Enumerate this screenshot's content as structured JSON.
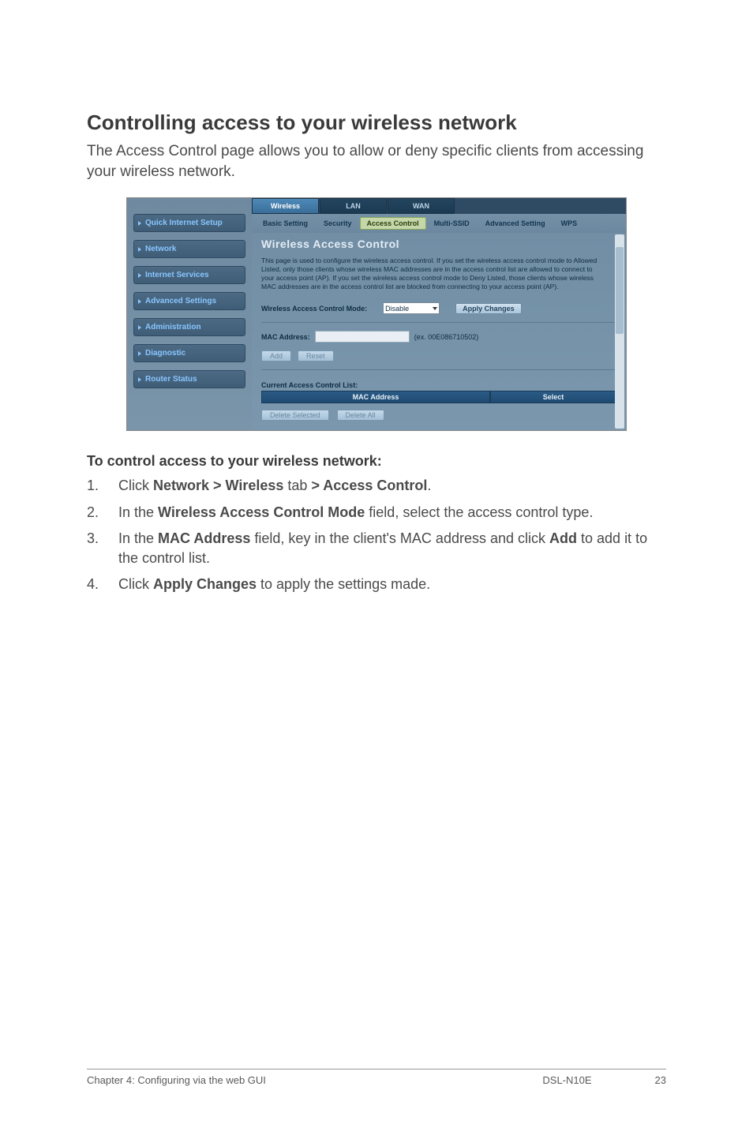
{
  "heading": "Controlling access to your wireless network",
  "intro": "The Access Control page allows you to allow or deny specific clients from accessing your wireless network.",
  "screenshot": {
    "nav": {
      "items": [
        "Quick Internet Setup",
        "Network",
        "Internet Services",
        "Advanced Settings",
        "Administration",
        "Diagnostic",
        "Router Status"
      ]
    },
    "top_tabs": {
      "items": [
        "Wireless",
        "LAN",
        "WAN"
      ],
      "active_index": 0
    },
    "sub_tabs": {
      "items": [
        "Basic Setting",
        "Security",
        "Access Control",
        "Multi-SSID",
        "Advanced Setting",
        "WPS"
      ],
      "active_index": 2
    },
    "panel": {
      "title": "Wireless Access Control",
      "desc": "This page is used to configure the wireless access control.\nIf you set the wireless access control mode to Allowed Listed, only those clients whose wireless MAC addresses are in the access control list are allowed to connect to your access point (AP).\nIf you set the wireless access control mode to Deny Listed, those clients whose wireless MAC addresses are in the access control list are blocked from connecting to your access point (AP).",
      "mode_label": "Wireless Access Control Mode:",
      "mode_value": "Disable",
      "apply_label": "Apply Changes",
      "mac_label": "MAC Address:",
      "mac_example": "(ex. 00E086710502)",
      "add_label": "Add",
      "reset_label": "Reset",
      "list_title": "Current Access Control List:",
      "col_mac": "MAC Address",
      "col_select": "Select",
      "del_sel": "Delete Selected",
      "del_all": "Delete All"
    }
  },
  "instructions": {
    "title": "To control access to your wireless network:",
    "steps": [
      {
        "num": "1.",
        "parts": [
          "Click ",
          "Network > Wireless",
          " tab ",
          "> Access Control",
          "."
        ]
      },
      {
        "num": "2.",
        "parts": [
          "In the ",
          "Wireless Access Control Mode",
          " field, select the access control type."
        ]
      },
      {
        "num": "3.",
        "parts": [
          "In the ",
          "MAC Address",
          " field, key in the client's MAC address and click ",
          "Add",
          " to add it to the control list."
        ]
      },
      {
        "num": "4.",
        "parts": [
          "Click ",
          "Apply Changes",
          " to apply the settings made."
        ]
      }
    ]
  },
  "footer": {
    "left": "Chapter 4: Configuring via the web GUI",
    "model": "DSL-N10E",
    "page": "23"
  }
}
